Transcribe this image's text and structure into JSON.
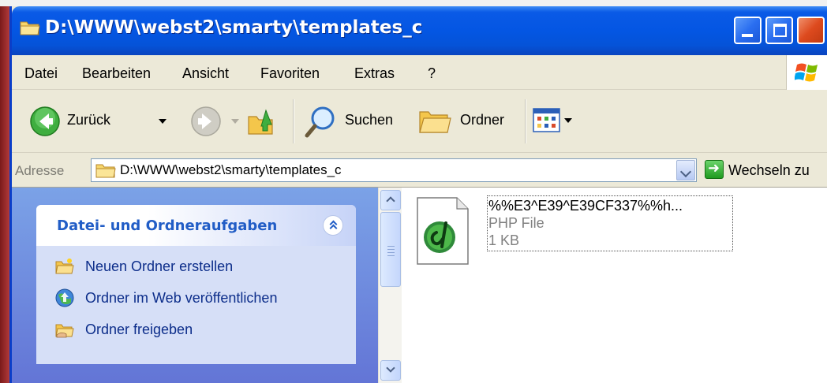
{
  "window": {
    "title": "D:\\WWW\\webst2\\smarty\\templates_c"
  },
  "menu": {
    "items": [
      {
        "label": "Datei"
      },
      {
        "label": "Bearbeiten"
      },
      {
        "label": "Ansicht"
      },
      {
        "label": "Favoriten"
      },
      {
        "label": "Extras"
      },
      {
        "label": "?"
      }
    ]
  },
  "toolbar": {
    "back_label": "Zurück",
    "search_label": "Suchen",
    "folders_label": "Ordner"
  },
  "address": {
    "label": "Adresse",
    "value": "D:\\WWW\\webst2\\smarty\\templates_c",
    "go_label": "Wechseln zu"
  },
  "task_pane": {
    "title": "Datei- und Ordneraufgaben",
    "items": [
      {
        "label": "Neuen Ordner erstellen",
        "icon": "new-folder-icon"
      },
      {
        "label": "Ordner im Web veröffentlichen",
        "icon": "publish-web-icon"
      },
      {
        "label": "Ordner freigeben",
        "icon": "share-folder-icon"
      }
    ]
  },
  "files": [
    {
      "name": "%%E3^E39^E39CF337%%h...",
      "type": "PHP File",
      "size": "1 KB",
      "icon": "dreamweaver-php-file-icon"
    }
  ],
  "colors": {
    "titlebar": "#0456e3",
    "task_title": "#215dc6",
    "task_link": "#0c2d8a",
    "task_pane_bg": "#6f8fdc"
  }
}
